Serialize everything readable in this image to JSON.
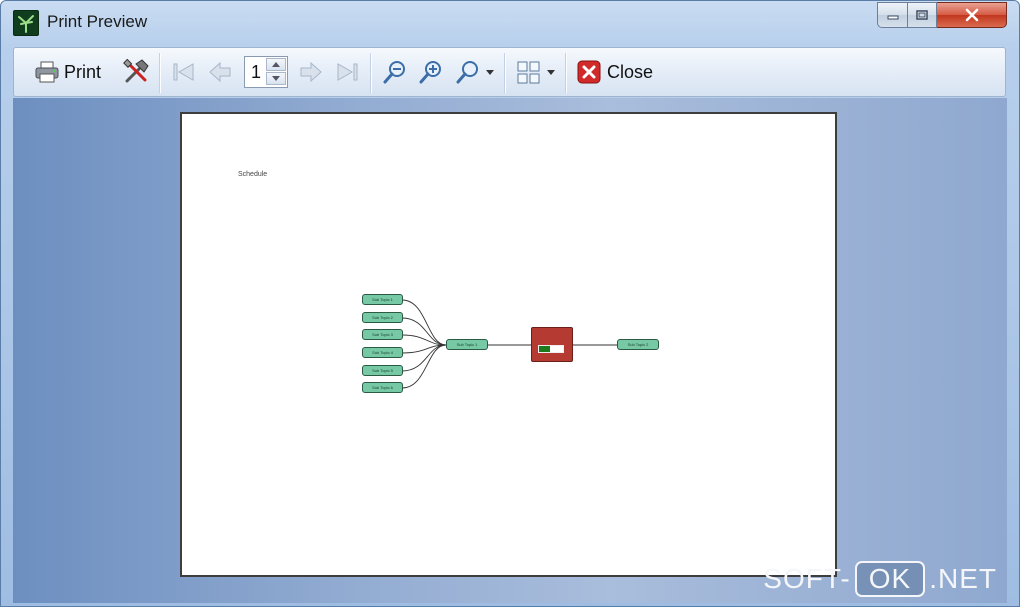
{
  "window": {
    "title": "Print Preview",
    "icon": "mindmap-app-icon",
    "controls": [
      "minimize-icon",
      "maximize-icon",
      "close-icon"
    ]
  },
  "toolbar": {
    "print_label": "Print",
    "page_value": "1",
    "close_label": "Close",
    "icons": [
      "printer-icon",
      "tools-icon",
      "first-page-icon",
      "previous-page-icon",
      "page-spinner",
      "next-page-icon",
      "last-page-icon",
      "zoom-out-icon",
      "zoom-in-icon",
      "zoom-dropdown-icon",
      "page-layout-icon",
      "close-red-icon"
    ]
  },
  "preview": {
    "header_text": "Schedule",
    "left_topics": [
      "Sub Topic 1",
      "Sub Topic 2",
      "Sub Topic 3",
      "Sub Topic 4",
      "Sub Topic 5",
      "Sub Topic 6"
    ],
    "middle_topic": "Sub Topic 1",
    "right_topic": "Sub Topic 2",
    "central_progress": 0.45
  },
  "watermark": {
    "left": "SOFT-",
    "middle": "OK",
    "right": ".NET"
  },
  "colors": {
    "topic_fill": "#76c9a4",
    "central_fill": "#b53a32",
    "progress_fill": "#1c7a1c",
    "close_button": "#d12a2a"
  }
}
